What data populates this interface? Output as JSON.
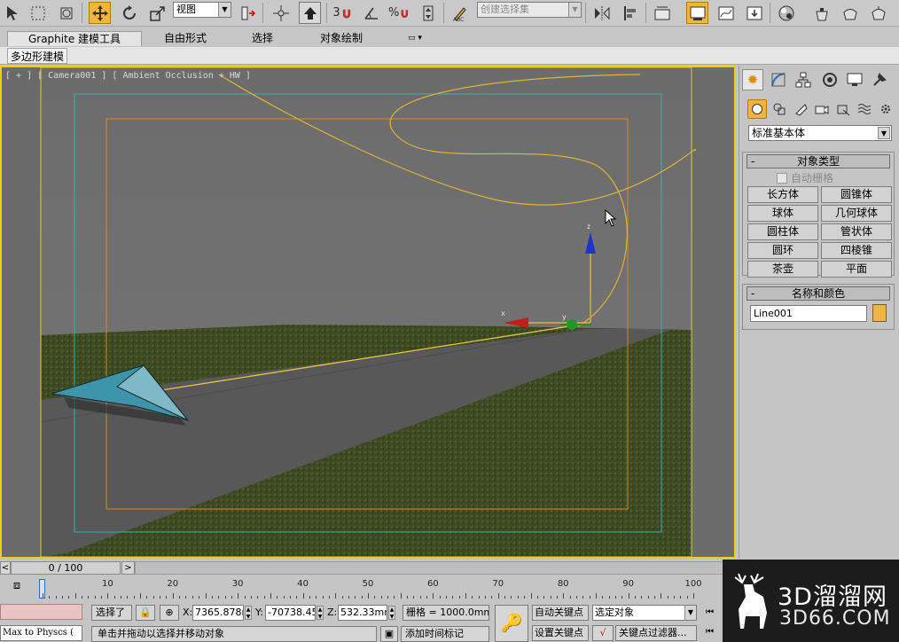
{
  "toolbar": {
    "view_dropdown": "视图",
    "selection_set_placeholder": "创建选择集",
    "snap_angle_label": "3",
    "percent_label": "%"
  },
  "ribbon": {
    "tabs": [
      "Graphite 建模工具",
      "自由形式",
      "选择",
      "对象绘制"
    ],
    "subtab": "多边形建模"
  },
  "viewport": {
    "label": "[ + ] [ Camera001 ] [ Ambient Occlusion + HW ]"
  },
  "command_panel": {
    "category_dropdown": "标准基本体",
    "object_type_title": "对象类型",
    "auto_grid_label": "自动栅格",
    "buttons": [
      "长方体",
      "圆锥体",
      "球体",
      "几何球体",
      "圆柱体",
      "管状体",
      "圆环",
      "四棱锥",
      "茶壶",
      "平面"
    ],
    "name_color_title": "名称和颜色",
    "object_name": "Line001",
    "object_color": "#f0b445"
  },
  "timeline": {
    "slider_label": "0 / 100",
    "ticks": [
      "10",
      "20",
      "30",
      "40",
      "50",
      "60",
      "70",
      "80",
      "90",
      "100"
    ]
  },
  "status": {
    "maxscript": "Max to Physcs (",
    "selection": "选择了",
    "x_label": "X:",
    "x_value": "7365.878m",
    "y_label": "Y:",
    "y_value": "-70738.45",
    "z_label": "Z:",
    "z_value": "532.33mm",
    "grid": "栅格 = 1000.0mm",
    "prompt": "单击并拖动以选择并移动对象",
    "add_time_tag": "添加时间标记",
    "auto_key": "自动关键点",
    "set_key": "设置关键点",
    "selected_dropdown": "选定对象",
    "key_filters": "关键点过滤器..."
  },
  "watermark": {
    "brand": "3D溜溜网",
    "url": "3D66.COM"
  }
}
